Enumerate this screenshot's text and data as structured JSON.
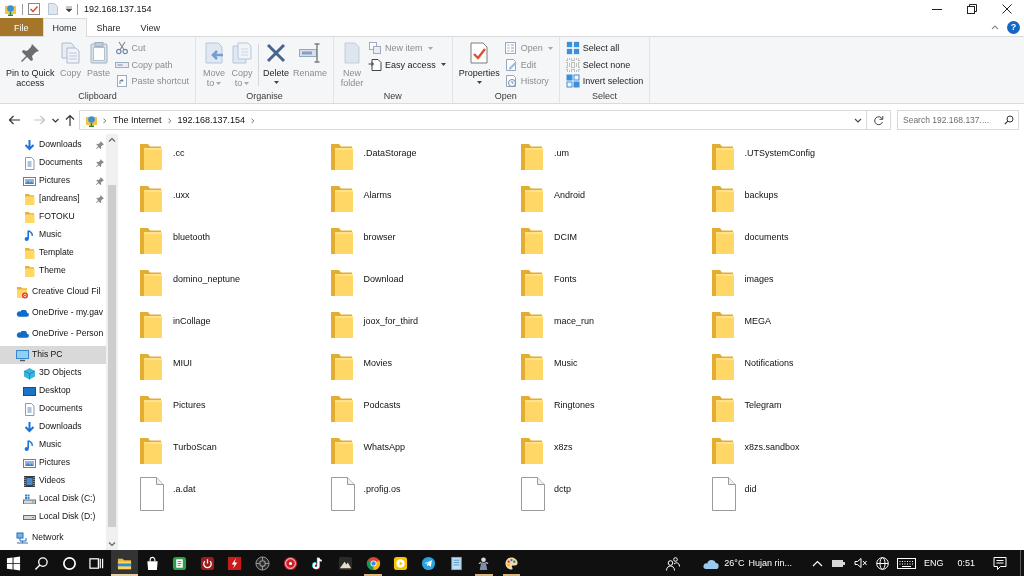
{
  "window": {
    "title": "192.168.137.154"
  },
  "ribbon_tabs": [
    {
      "label": "File",
      "kind": "menu",
      "selected": false
    },
    {
      "label": "Home",
      "kind": "tab",
      "selected": true
    },
    {
      "label": "Share",
      "kind": "tab",
      "selected": false
    },
    {
      "label": "View",
      "kind": "tab",
      "selected": false
    }
  ],
  "help_button": {
    "label": "?"
  },
  "ribbon": {
    "groups": [
      {
        "label": "Clipboard",
        "buttons": [
          {
            "kind": "large",
            "lines": [
              "Pin to Quick",
              "access"
            ],
            "disabled": false,
            "dropdown": false
          },
          {
            "kind": "large",
            "lines": [
              "Copy"
            ],
            "disabled": true,
            "dropdown": false
          },
          {
            "kind": "large",
            "lines": [
              "Paste"
            ],
            "disabled": true,
            "dropdown": false
          },
          {
            "kind": "small",
            "label": "Cut",
            "disabled": true,
            "dropdown": false
          },
          {
            "kind": "small",
            "label": "Copy path",
            "disabled": true,
            "dropdown": false
          },
          {
            "kind": "small",
            "label": "Paste shortcut",
            "disabled": true,
            "dropdown": false
          }
        ]
      },
      {
        "label": "Organise",
        "buttons": [
          {
            "kind": "large",
            "lines": [
              "Move",
              "to"
            ],
            "disabled": true,
            "dropdown": true
          },
          {
            "kind": "large",
            "lines": [
              "Copy",
              "to"
            ],
            "disabled": true,
            "dropdown": true
          },
          {
            "kind": "large",
            "lines": [
              "Delete"
            ],
            "disabled": false,
            "dropdown": true,
            "divider_before": true
          },
          {
            "kind": "large",
            "lines": [
              "Rename"
            ],
            "disabled": true,
            "dropdown": false
          }
        ]
      },
      {
        "label": "New",
        "buttons": [
          {
            "kind": "large",
            "lines": [
              "New",
              "folder"
            ],
            "disabled": true,
            "dropdown": false
          },
          {
            "kind": "small",
            "label": "New item",
            "disabled": true,
            "dropdown": true
          },
          {
            "kind": "small",
            "label": "Easy access",
            "disabled": false,
            "dropdown": true
          }
        ]
      },
      {
        "label": "Open",
        "buttons": [
          {
            "kind": "large",
            "lines": [
              "Properties"
            ],
            "disabled": false,
            "dropdown": true
          },
          {
            "kind": "small",
            "label": "Open",
            "disabled": true,
            "dropdown": true
          },
          {
            "kind": "small",
            "label": "Edit",
            "disabled": true,
            "dropdown": false
          },
          {
            "kind": "small",
            "label": "History",
            "disabled": true,
            "dropdown": false
          }
        ]
      },
      {
        "label": "Select",
        "buttons": [
          {
            "kind": "small",
            "label": "Select all",
            "disabled": false,
            "dropdown": false
          },
          {
            "kind": "small",
            "label": "Select none",
            "disabled": false,
            "dropdown": false
          },
          {
            "kind": "small",
            "label": "Invert selection",
            "disabled": false,
            "dropdown": false
          }
        ]
      }
    ]
  },
  "nav_buttons": [
    {
      "kind": "back",
      "disabled": false
    },
    {
      "kind": "forward",
      "disabled": true
    },
    {
      "kind": "recent",
      "disabled": false
    },
    {
      "kind": "up",
      "disabled": false
    }
  ],
  "address_bar": {
    "breadcrumbs": [
      "The Internet",
      "192.168.137.154"
    ]
  },
  "search": {
    "placeholder": "Search 192.168.137...."
  },
  "nav_pane": {
    "quick_access": [
      {
        "label": "Downloads",
        "kind": "downloads",
        "pinned": true,
        "selected": false
      },
      {
        "label": "Documents",
        "kind": "documents",
        "pinned": true,
        "selected": false
      },
      {
        "label": "Pictures",
        "kind": "pictures",
        "pinned": true,
        "selected": false
      },
      {
        "label": "[andreans]",
        "kind": "folder",
        "pinned": true,
        "selected": false
      },
      {
        "label": "FOTOKU",
        "kind": "folder",
        "pinned": false,
        "selected": false
      },
      {
        "label": "Music",
        "kind": "music",
        "pinned": false,
        "selected": false
      },
      {
        "label": "Template",
        "kind": "folder",
        "pinned": false,
        "selected": false
      },
      {
        "label": "Theme",
        "kind": "folder",
        "pinned": false,
        "selected": false
      }
    ],
    "items": [
      {
        "label": "Creative Cloud Fil",
        "kind": "creativecloud",
        "selected": false
      },
      {
        "label": "OneDrive - my.gav",
        "kind": "onedrive",
        "selected": false
      },
      {
        "label": "OneDrive - Person",
        "kind": "onedrive",
        "selected": false
      },
      {
        "label": "This PC",
        "kind": "pc",
        "selected": true,
        "children": [
          {
            "label": "3D Objects",
            "kind": "objects",
            "selected": false
          },
          {
            "label": "Desktop",
            "kind": "desktop",
            "selected": false
          },
          {
            "label": "Documents",
            "kind": "documents",
            "selected": false
          },
          {
            "label": "Downloads",
            "kind": "downloads",
            "selected": false
          },
          {
            "label": "Music",
            "kind": "music",
            "selected": false
          },
          {
            "label": "Pictures",
            "kind": "pictures",
            "selected": false
          },
          {
            "label": "Videos",
            "kind": "videos",
            "selected": false
          },
          {
            "label": "Local Disk (C:)",
            "kind": "systemdisk",
            "selected": false
          },
          {
            "label": "Local Disk (D:)",
            "kind": "disk",
            "selected": false
          }
        ]
      },
      {
        "label": "Network",
        "kind": "network",
        "selected": false
      }
    ]
  },
  "content": {
    "items": [
      {
        "name": ".cc",
        "kind": "folder"
      },
      {
        "name": ".DataStorage",
        "kind": "folder"
      },
      {
        "name": ".um",
        "kind": "folder"
      },
      {
        "name": ".UTSystemConfig",
        "kind": "folder"
      },
      {
        "name": ".uxx",
        "kind": "folder"
      },
      {
        "name": "Alarms",
        "kind": "folder"
      },
      {
        "name": "Android",
        "kind": "folder"
      },
      {
        "name": "backups",
        "kind": "folder"
      },
      {
        "name": "bluetooth",
        "kind": "folder"
      },
      {
        "name": "browser",
        "kind": "folder"
      },
      {
        "name": "DCIM",
        "kind": "folder"
      },
      {
        "name": "documents",
        "kind": "folder"
      },
      {
        "name": "domino_neptune",
        "kind": "folder"
      },
      {
        "name": "Download",
        "kind": "folder"
      },
      {
        "name": "Fonts",
        "kind": "folder"
      },
      {
        "name": "images",
        "kind": "folder"
      },
      {
        "name": "inCollage",
        "kind": "folder"
      },
      {
        "name": "joox_for_third",
        "kind": "folder"
      },
      {
        "name": "mace_run",
        "kind": "folder"
      },
      {
        "name": "MEGA",
        "kind": "folder"
      },
      {
        "name": "MIUI",
        "kind": "folder"
      },
      {
        "name": "Movies",
        "kind": "folder"
      },
      {
        "name": "Music",
        "kind": "folder"
      },
      {
        "name": "Notifications",
        "kind": "folder"
      },
      {
        "name": "Pictures",
        "kind": "folder"
      },
      {
        "name": "Podcasts",
        "kind": "folder"
      },
      {
        "name": "Ringtones",
        "kind": "folder"
      },
      {
        "name": "Telegram",
        "kind": "folder"
      },
      {
        "name": "TurboScan",
        "kind": "folder"
      },
      {
        "name": "WhatsApp",
        "kind": "folder"
      },
      {
        "name": "x8zs",
        "kind": "folder"
      },
      {
        "name": "x8zs.sandbox",
        "kind": "folder"
      },
      {
        "name": ".a.dat",
        "kind": "file"
      },
      {
        "name": ".profig.os",
        "kind": "file"
      },
      {
        "name": "dctp",
        "kind": "file"
      },
      {
        "name": "did",
        "kind": "file"
      }
    ]
  },
  "taskbar": {
    "apps": [
      {
        "running": true,
        "selected": true
      },
      {
        "running": false,
        "selected": false
      },
      {
        "running": false,
        "selected": false
      },
      {
        "running": false,
        "selected": false
      },
      {
        "running": false,
        "selected": false
      },
      {
        "running": false,
        "selected": false
      },
      {
        "running": false,
        "selected": false
      },
      {
        "running": false,
        "selected": false
      },
      {
        "running": false,
        "selected": false
      },
      {
        "running": true,
        "selected": false
      },
      {
        "running": false,
        "selected": false
      },
      {
        "running": false,
        "selected": false
      },
      {
        "running": false,
        "selected": false
      },
      {
        "running": true,
        "selected": false
      },
      {
        "running": true,
        "selected": false
      }
    ],
    "weather": {
      "temperature": "26°C",
      "condition": "Hujan rin..."
    },
    "language": "ENG",
    "time": "0:51"
  }
}
